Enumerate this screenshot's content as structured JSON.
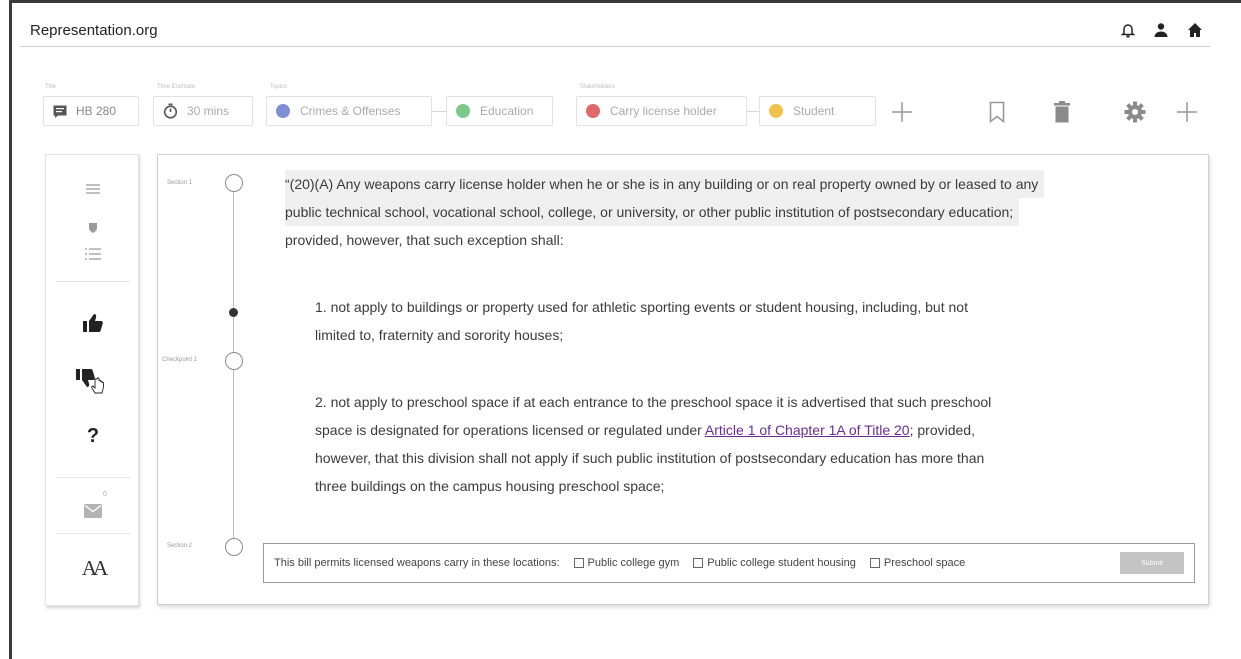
{
  "app": {
    "site_title": "Representation.org"
  },
  "header_icons": [
    "bell-icon",
    "user-icon",
    "home-icon"
  ],
  "toolbar": {
    "title_label": "Title",
    "title_value": "HB 280",
    "time_label": "Time Estimate",
    "time_value": "30 mins",
    "topics_label": "Topics",
    "topics": [
      {
        "label": "Crimes & Offenses",
        "color": "#7f8fd6"
      },
      {
        "label": "Education",
        "color": "#7dc98a"
      }
    ],
    "stakeholders_label": "Stakeholders",
    "stakeholders": [
      {
        "label": "Carry license holder",
        "color": "#e06a6a"
      },
      {
        "label": "Student",
        "color": "#f2c24f"
      }
    ],
    "actions": [
      "plus-icon",
      "bookmark-icon",
      "trash-icon",
      "gear-icon",
      "plus-icon"
    ]
  },
  "sidebar": {
    "items": [
      "menu-icon",
      "shield-list-icon",
      "thumbs-up-icon",
      "thumbs-down-icon",
      "question-icon",
      "mail-icon",
      "text-size-icon"
    ],
    "question_glyph": "?",
    "mail_count": "0",
    "text_size_glyph": "AA"
  },
  "timeline": {
    "section1": "Section 1",
    "checkpoint1": "Checkpoint 1",
    "section2": "Section 2"
  },
  "bill": {
    "para_intro": "“(20)(A) Any weapons carry license holder when he or she is in any building or on real property owned by or leased to any",
    "para_line2": "public technical school, vocational school, college, or university, or other public institution of postsecondary education;",
    "para_line3": "provided, however, that such exception shall:",
    "item1_line1": "1. not apply to buildings or property used for athletic sporting events or student  housing, including, but not",
    "item1_line2": "limited to, fraternity and sorority houses;",
    "item2_line1": "2. not apply to preschool space if at each entrance to the preschool space it is advertised that such preschool",
    "item2_line2_pre": "space is designated for operations licensed or regulated under ",
    "item2_link": "Article 1 of Chapter 1A of Title 20",
    "item2_line2_post": "; provided,",
    "item2_line3": "however, that this division shall not apply if such public institution of postsecondary education has more than",
    "item2_line4": "three buildings on the campus housing preschool space;"
  },
  "quiz": {
    "question": "This bill permits licensed weapons carry in these locations:",
    "options": [
      "Public college gym",
      "Public college student housing",
      "Preschool space"
    ],
    "submit": "Submit"
  }
}
